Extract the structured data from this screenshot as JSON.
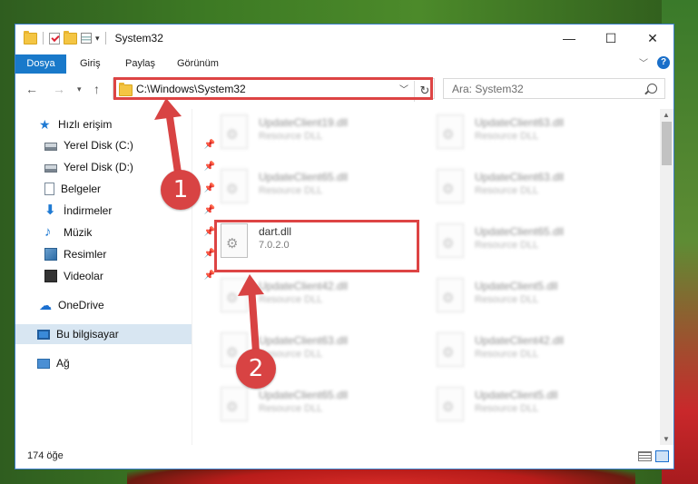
{
  "window": {
    "title": "System32",
    "controls": {
      "minimize": "—",
      "maximize": "☐",
      "close": "✕"
    }
  },
  "ribbon": {
    "tabs": [
      "Dosya",
      "Giriş",
      "Paylaş",
      "Görünüm"
    ],
    "help": "?"
  },
  "address": {
    "path": "C:\\Windows\\System32",
    "search_placeholder": "Ara: System32"
  },
  "nav": {
    "items": [
      {
        "label": "Hızlı erişim",
        "icon": "star-icon"
      },
      {
        "label": "Yerel Disk (C:)",
        "icon": "disk-icon"
      },
      {
        "label": "Yerel Disk (D:)",
        "icon": "disk-icon"
      },
      {
        "label": "Belgeler",
        "icon": "documents-icon"
      },
      {
        "label": "İndirmeler",
        "icon": "downloads-icon"
      },
      {
        "label": "Müzik",
        "icon": "music-icon"
      },
      {
        "label": "Resimler",
        "icon": "pictures-icon"
      },
      {
        "label": "Videolar",
        "icon": "videos-icon"
      },
      {
        "label": "OneDrive",
        "icon": "cloud-icon"
      },
      {
        "label": "Bu bilgisayar",
        "icon": "computer-icon"
      },
      {
        "label": "Ağ",
        "icon": "network-icon"
      }
    ]
  },
  "files": {
    "left": [
      {
        "name": "UpdateClient19.dll",
        "type": "Resource DLL"
      },
      {
        "name": "UpdateClient65.dll",
        "type": "Resource DLL"
      },
      {
        "name": "dart.dll",
        "type": "7.0.2.0"
      },
      {
        "name": "UpdateClient42.dll",
        "type": "Resource DLL"
      },
      {
        "name": "UpdateClient63.dll",
        "type": "Resource DLL"
      },
      {
        "name": "UpdateClient65.dll",
        "type": "Resource DLL"
      }
    ],
    "right": [
      {
        "name": "UpdateClient63.dll",
        "type": "Resource DLL"
      },
      {
        "name": "UpdateClient63.dll",
        "type": "Resource DLL"
      },
      {
        "name": "UpdateClient65.dll",
        "type": "Resource DLL"
      },
      {
        "name": "UpdateClient5.dll",
        "type": "Resource DLL"
      },
      {
        "name": "UpdateClient42.dll",
        "type": "Resource DLL"
      },
      {
        "name": "UpdateClient5.dll",
        "type": "Resource DLL"
      }
    ]
  },
  "status": {
    "count": "174 öğe"
  },
  "annotations": {
    "step1": "1",
    "step2": "2",
    "color": "#d84343"
  }
}
